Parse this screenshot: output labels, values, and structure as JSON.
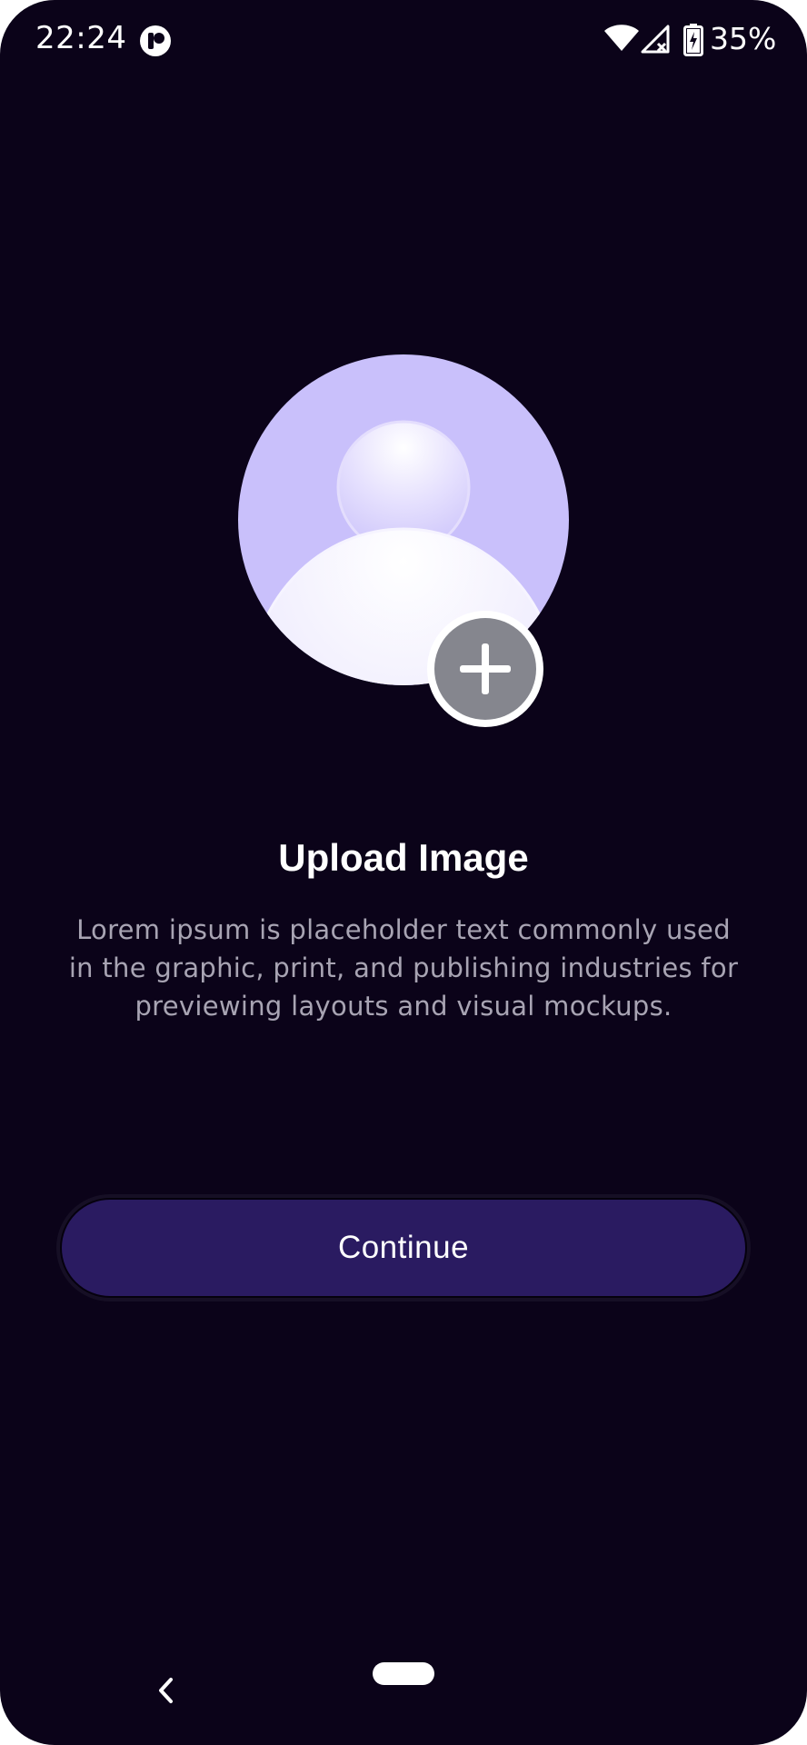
{
  "status_bar": {
    "time": "22:24",
    "battery_percent": "35%",
    "icons": [
      "app-notification-icon",
      "wifi-icon",
      "signal-no-service-icon",
      "battery-charging-icon"
    ]
  },
  "main": {
    "title": "Upload Image",
    "description": "Lorem ipsum is placeholder text commonly used in the graphic, print, and publishing industries for previewing layouts and visual mockups.",
    "avatar_icon": "user-avatar-placeholder-icon",
    "add_icon": "plus-icon"
  },
  "actions": {
    "continue_label": "Continue"
  },
  "nav_bar": {
    "icons": [
      "back-icon",
      "home-pill"
    ]
  },
  "colors": {
    "background": "#0b0319",
    "avatar_bg": "#c9c0fb",
    "button_bg": "#2a1b61",
    "add_button_bg": "#85868e",
    "description_text": "#a8a4b3"
  }
}
